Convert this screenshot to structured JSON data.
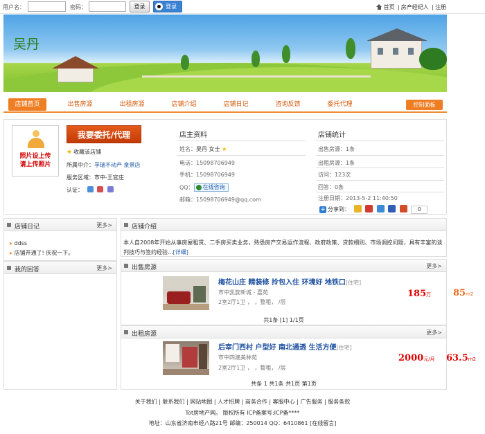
{
  "topbar": {
    "username_label": "用户名：",
    "password_label": "密码：",
    "login_button": "登录",
    "qq_login": "登录",
    "links": [
      "首页",
      "房产经纪人",
      "注册"
    ]
  },
  "banner": {
    "shop_name": "吴丹"
  },
  "nav": {
    "items": [
      "店铺首页",
      "出售房源",
      "出租房源",
      "店铺介绍",
      "店铺日记",
      "咨询反馈",
      "委托代理"
    ],
    "control_panel": "控制面板"
  },
  "profile": {
    "photo_text_1": "照片设上传",
    "photo_text_2": "请上传照片",
    "entrust_button": "我要委托/代理",
    "favorite": "收藏该店铺",
    "agency_label": "所属中介：",
    "agency_value": "孚瑞不动产 泉景店",
    "area_label": "服务区域：",
    "area_value": "市中-王官庄",
    "cert_label": "认证："
  },
  "owner": {
    "heading": "店主资料",
    "name_label": "姓名：",
    "name_value": "吴丹 女士",
    "phone_label": "电话：",
    "phone_value": "15098706949",
    "mobile_label": "手机：",
    "mobile_value": "15098706949",
    "qq_label": "QQ：",
    "qq_chat": "在线咨询",
    "email_label": "邮箱：",
    "email_value": "15098706949@qq.com"
  },
  "stats": {
    "heading": "店铺统计",
    "sale_label": "出售房源：",
    "sale_value": "1条",
    "rent_label": "出租房源：",
    "rent_value": "1条",
    "visit_label": "访问：",
    "visit_value": "123次",
    "reply_label": "回答：",
    "reply_value": "0条",
    "reg_label": "注册日期：",
    "reg_value": "2013-5-2 11:40:50",
    "share_label": "分享到：",
    "share_count": "0"
  },
  "diary": {
    "title": "店铺日记",
    "more": "更多>",
    "entries": [
      "ddss",
      "店铺开通了! 庆祝一下。"
    ]
  },
  "answers": {
    "title": "我的回答",
    "more": "更多>"
  },
  "intro": {
    "title": "店铺介绍",
    "text_1": "本人自2008年开始从事房屋租赁、二手房买卖业务，熟悉房产交易运作流程、政府政策、贷款细则、市场调控问题，具有丰富的谈",
    "text_2": "判技巧与签约经验...",
    "detail_link": "[详细]"
  },
  "sale": {
    "title": "出售房源",
    "more": "更多>",
    "listing_title": "梅花山庄 精装修 拎包入住 环境好 地铁口",
    "listing_tag": "[住宅]",
    "location": "市中凯旋新城 - 嘉苑",
    "detail": "2室2厅1卫 ， ，整租， /层",
    "price": "185",
    "price_unit": "万",
    "area": "85",
    "area_unit": "m2",
    "pager": "共1条 [1] 1/1页"
  },
  "rent": {
    "title": "出租房源",
    "more": "更多>",
    "listing_title": "后宰门西村 户型好 南北通透 生活方便",
    "listing_tag": "[住宅]",
    "location": "市中四建美林苑",
    "detail": "2室2厅1卫 ， ，整租， /层",
    "price": "2000",
    "price_unit": "元/月",
    "area": "63.5",
    "area_unit": "m2",
    "pager": "共条  1 共1条  共1页  第1页"
  },
  "footer": {
    "links": "关于我们 | 联系我们 | 网站地图 | 人才招聘 | 商务合作 | 客服中心 | 广告服务 | 服务条款",
    "copyright": "Tot房地产网。 版权所有 ICP备案号:ICP备****",
    "address": "地址：山东省济南市经八路21号 邮编：250014 QQ：6410861 [在线留言]"
  }
}
